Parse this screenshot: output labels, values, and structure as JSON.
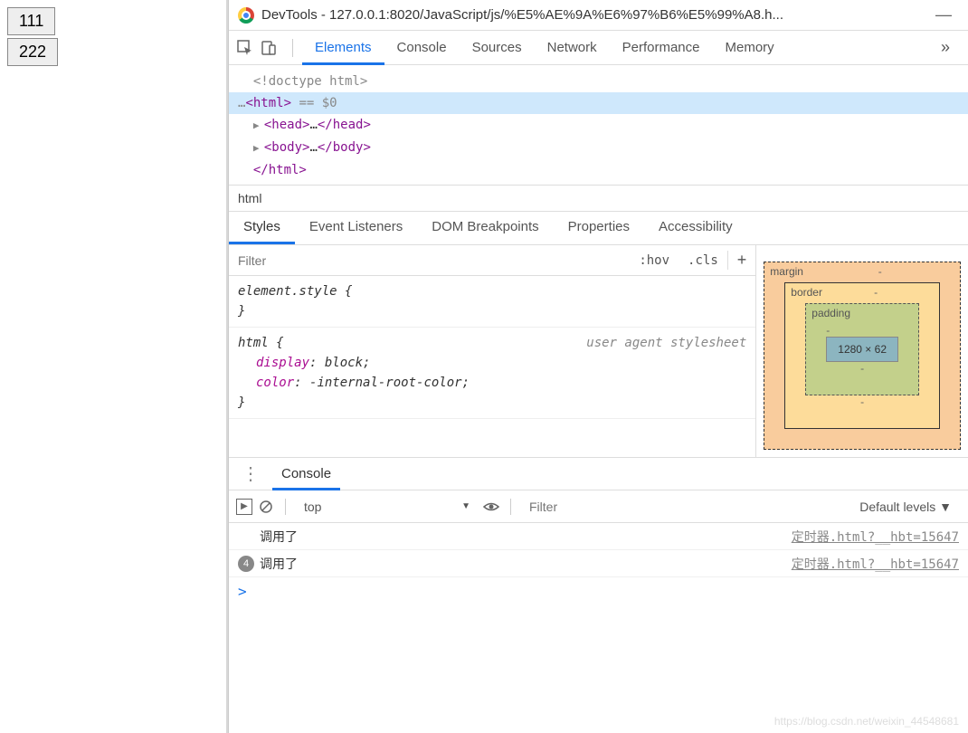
{
  "page_buttons": [
    "111",
    "222"
  ],
  "devtools": {
    "title": "DevTools - 127.0.0.1:8020/JavaScript/js/%E5%AE%9A%E6%97%B6%E5%99%A8.h...",
    "tabs": [
      "Elements",
      "Console",
      "Sources",
      "Network",
      "Performance",
      "Memory"
    ],
    "active_tab": "Elements",
    "dom": {
      "doctype": "<!doctype html>",
      "html_open": "<html>",
      "html_eq": " == $0",
      "head": "<head>…</head>",
      "body": "<body>…</body>",
      "html_close": "</html>"
    },
    "breadcrumb": "html",
    "subtabs": [
      "Styles",
      "Event Listeners",
      "DOM Breakpoints",
      "Properties",
      "Accessibility"
    ],
    "active_subtab": "Styles",
    "styles": {
      "filter_placeholder": "Filter",
      "hov": ":hov",
      "cls": ".cls",
      "element_style": "element.style {",
      "brace_close": "}",
      "html_rule_sel": "html {",
      "html_rule_src": "user agent stylesheet",
      "p1_name": "display",
      "p1_val": ": block;",
      "p2_name": "color",
      "p2_val": ": -internal-root-color;"
    },
    "box_model": {
      "margin": "margin",
      "border": "border",
      "padding": "padding",
      "content": "1280 × 62",
      "dash": "-"
    },
    "console": {
      "label": "Console",
      "ctx": "top",
      "filter_placeholder": "Filter",
      "levels": "Default levels ▼",
      "logs": [
        {
          "badge": "",
          "msg": "调用了",
          "src": "定时器.html?__hbt=15647"
        },
        {
          "badge": "4",
          "msg": "调用了",
          "src": "定时器.html?__hbt=15647"
        }
      ],
      "prompt": ">"
    }
  },
  "watermark": "https://blog.csdn.net/weixin_44548681"
}
